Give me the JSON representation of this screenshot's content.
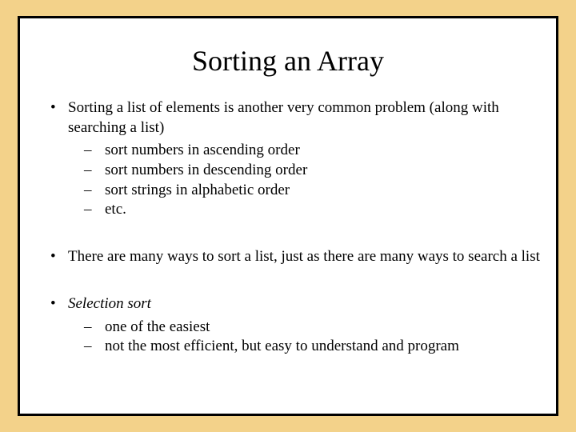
{
  "title": "Sorting an Array",
  "bullets": {
    "b1": {
      "text": "Sorting a list of elements is another very common problem (along with searching a list)",
      "sub": {
        "s1": "sort numbers in ascending order",
        "s2": "sort numbers in descending order",
        "s3": "sort strings in alphabetic order",
        "s4": "etc."
      }
    },
    "b2": {
      "text": "There are many ways to sort a list, just as there are many ways to search a list"
    },
    "b3": {
      "text": "Selection sort",
      "sub": {
        "s1": "one of the easiest",
        "s2": "not the most efficient, but easy to understand and program"
      }
    }
  }
}
